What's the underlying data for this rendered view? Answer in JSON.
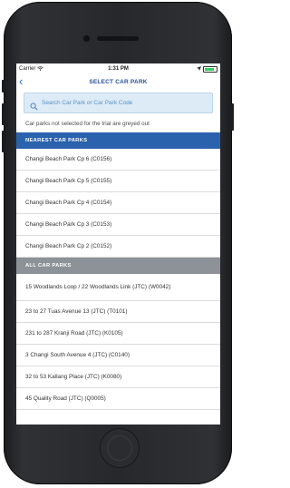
{
  "status_bar": {
    "carrier": "Carrier",
    "time": "1:31 PM"
  },
  "nav": {
    "title": "SELECT CAR PARK",
    "back_glyph": "‹"
  },
  "search": {
    "placeholder": "Search Car Park or Car Park Code",
    "icon": "search-icon"
  },
  "note": "Car parks not selected for the trial are greyed out",
  "nearest": {
    "header": "NEAREST CAR PARKS",
    "items": [
      "Changi Beach Park Cp 6 (C0156)",
      "Changi Beach Park Cp 5 (C0155)",
      "Changi Beach Park Cp 4 (C0154)",
      "Changi Beach Park Cp 3 (C0153)",
      "Changi Beach Park Cp 2 (C0152)"
    ]
  },
  "all": {
    "header": "ALL CAR PARKS",
    "items": [
      "15 Woodlands Loop / 22 Woodlands Link (JTC) (W0042)",
      "23 to 27 Tuas Avenue 13 (JTC) (T0101)",
      "231 to 287 Kranji Road (JTC) (K0105)",
      "3 Changi South Avenue 4 (JTC) (C0140)",
      "32 to 53 Kallang Place (JTC) (K0080)",
      "45 Quality Road (JTC) (Q0005)"
    ]
  },
  "colors": {
    "accent_blue": "#2a62ad",
    "section_gray": "#8c9297",
    "search_bg": "#dcebf6",
    "title_blue": "#284e9a"
  }
}
